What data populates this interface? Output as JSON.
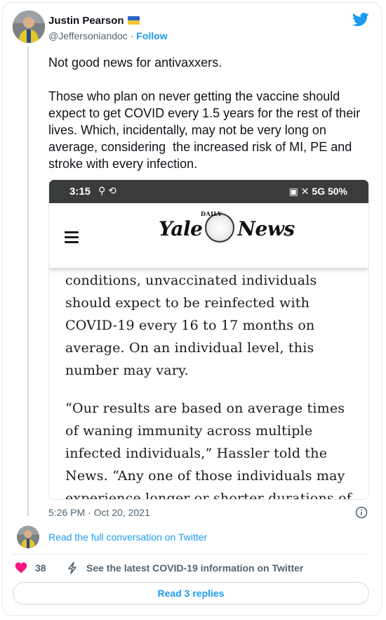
{
  "author": {
    "name": "Justin Pearson",
    "handle": "@Jeffersoniandoc",
    "separator": " · ",
    "follow_label": "Follow"
  },
  "tweet": {
    "text": "Not good news for antivaxxers.\n\nThose who plan on never getting the vaccine should expect to get COVID every 1.5 years for the rest of their lives. Which, incidentally, may not be very long on average, considering  the increased risk of MI, PE and stroke with every infection.",
    "timestamp": "5:26 PM · Oct 20, 2021"
  },
  "screenshot": {
    "status_time": "3:15",
    "status_left_icons": "⚲ ⟲",
    "status_right": "5G 50%",
    "masthead_left": "Yale",
    "masthead_small": "DAILY",
    "masthead_right": "News",
    "paragraph_1": "conditions, unvaccinated individuals should expect to be reinfected with COVID-19 every 16 to 17 months on average. On an individual level, this number may vary.",
    "paragraph_2": "“Our results are based on average times of waning immunity across multiple infected individuals,” Hassler told the News. “Any one of those individuals may experience longer or shorter durations of"
  },
  "footer": {
    "read_conversation": "Read the full conversation on Twitter",
    "likes_count": "38",
    "covid_info": "See the latest COVID-19 information on Twitter",
    "read_replies": "Read 3 replies"
  },
  "icons": {
    "twitter": "twitter-bird-icon",
    "info": "info-icon",
    "heart": "heart-icon",
    "bolt": "lightning-icon",
    "menu": "hamburger-menu-icon"
  },
  "colors": {
    "accent": "#1d9bf0",
    "heart": "#f91880",
    "muted": "#536471",
    "flag_blue": "#2a68c7",
    "flag_yellow": "#f4c430"
  }
}
